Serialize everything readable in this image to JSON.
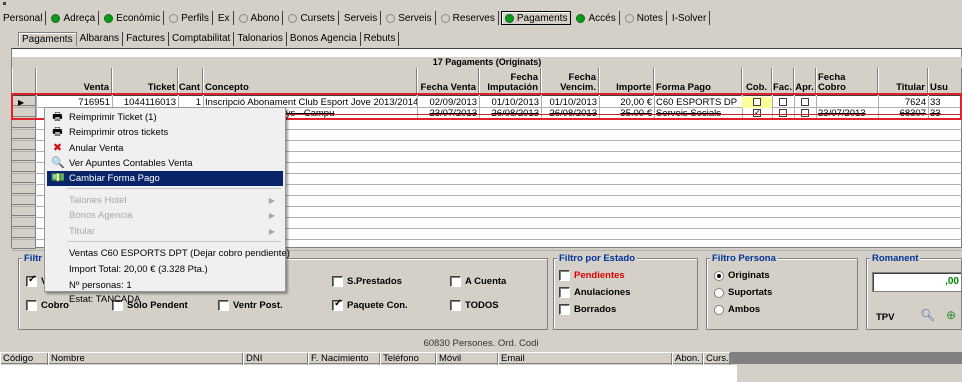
{
  "top_tabs": [
    {
      "label": "Personal",
      "dot": "none"
    },
    {
      "label": "Adreça",
      "dot": "green"
    },
    {
      "label": "Econòmic",
      "dot": "green"
    },
    {
      "label": "Perfils",
      "dot": "grey"
    },
    {
      "label": "Ex",
      "dot": "none"
    },
    {
      "label": "Abono",
      "dot": "grey"
    },
    {
      "label": "Cursets",
      "dot": "grey"
    },
    {
      "label": "Serveis",
      "dot": "none"
    },
    {
      "label": "Serveis",
      "dot": "grey"
    },
    {
      "label": "Reserves",
      "dot": "grey"
    },
    {
      "label": "Pagaments",
      "dot": "green",
      "active": true
    },
    {
      "label": "Accés",
      "dot": "green"
    },
    {
      "label": "Notes",
      "dot": "grey"
    },
    {
      "label": "I-Solver",
      "dot": "none"
    }
  ],
  "sub_tabs": [
    "Pagaments",
    "Albarans",
    "Factures",
    "Comptabilitat",
    "Talonarios",
    "Bonos Agencia",
    "Rebuts"
  ],
  "grid": {
    "caption": "17 Pagaments (Originats)",
    "columns": {
      "venta": "Venta",
      "ticket": "Ticket",
      "cant": "Cant",
      "concepto": "Concepto",
      "fecha_venta": "Fecha Venta",
      "fecha_imputacion": "Fecha Imputación",
      "fecha_vencim": "Fecha Vencim.",
      "importe": "Importe",
      "forma_pago": "Forma Pago",
      "cob": "Cob.",
      "fac": "Fac.",
      "apr": "Apr.",
      "fecha_cobro": "Fecha Cobro",
      "titular": "Titular",
      "usu": "Usu"
    },
    "rows": [
      {
        "venta": "716951",
        "ticket": "1044116013",
        "cant": "1",
        "concepto": "Inscripció Abonament Club Esport Jove 2013/2014",
        "fecha_venta": "02/09/2013",
        "fecha_imputacion": "01/10/2013",
        "fecha_vencim": "01/10/2013",
        "importe": "20,00 €",
        "forma_pago": "C60 ESPORTS DP",
        "cob": false,
        "fac": false,
        "apr": false,
        "fecha_cobro": "",
        "titular": "7624",
        "usu": "33"
      },
      {
        "venta": "",
        "ticket": "",
        "cant": "",
        "concepto": "3 Prat de 7 a 16 anys - Campu",
        "fecha_venta": "23/07/2013",
        "fecha_imputacion": "26/08/2013",
        "fecha_vencim": "26/08/2013",
        "importe": "35.00 €",
        "forma_pago": "Serveis Socials",
        "cob": true,
        "fac": false,
        "apr": false,
        "fecha_cobro": "23/07/2013",
        "titular": "68307",
        "usu": "33"
      }
    ]
  },
  "context_menu": {
    "items": [
      {
        "label": "Reimprimir Ticket (1)",
        "icon": "printer-icon",
        "glyph": "🖶",
        "disabled": false,
        "highlighted": false,
        "submenu": false
      },
      {
        "label": "Reimprimir otros tickets",
        "icon": "printer-icon",
        "glyph": "🖶",
        "disabled": false,
        "highlighted": false,
        "submenu": false
      },
      {
        "label": "Anular Venta",
        "icon": "red-x-icon",
        "glyph": "✖",
        "disabled": false,
        "highlighted": false,
        "submenu": false
      },
      {
        "label": "Ver Apuntes Contables Venta",
        "icon": "magnifier-icon",
        "glyph": "🔍",
        "disabled": false,
        "highlighted": false,
        "submenu": false
      },
      {
        "label": "Cambiar Forma Pago",
        "icon": "money-icon",
        "glyph": "💵",
        "disabled": false,
        "highlighted": true,
        "submenu": false
      },
      {
        "label": "Talones Hotel",
        "disabled": true,
        "submenu": true
      },
      {
        "label": "Bonos Agencia",
        "disabled": true,
        "submenu": true
      },
      {
        "label": "Titular",
        "disabled": true,
        "submenu": true
      },
      {
        "label": "Ventas C60 ESPORTS DPT (Dejar cobro pendiente)",
        "disabled": false,
        "submenu": false
      },
      {
        "label": "Import Total: 20,00 € (3.328 Pta.)",
        "disabled": false,
        "submenu": false
      },
      {
        "label": "Nº personas: 1",
        "disabled": false,
        "submenu": false
      },
      {
        "label": "Estat: TANCADA",
        "disabled": false,
        "submenu": false
      }
    ]
  },
  "filters": {
    "left_label": "Filtr",
    "left_check_v": "V",
    "left_cobro": "Cobro",
    "left_hidden_1": "Sólo Pendent",
    "left_hidden_2": "Ventr Post.",
    "s_prestados": "S.Prestados",
    "a_cuenta": "A Cuenta",
    "paquete_con": "Paquete Con.",
    "todos": "TODOS",
    "estado": {
      "title": "Filtro por Estado",
      "pendientes": "Pendientes",
      "anulaciones": "Anulaciones",
      "borrados": "Borrados"
    },
    "persona": {
      "title": "Filtro Persona",
      "originats": "Originats",
      "suportats": "Suportats",
      "ambos": "Ambos"
    },
    "romanent": {
      "title": "Romanent",
      "value": ",00",
      "tpv": "TPV"
    }
  },
  "status_line": "60830 Persones. Ord. Codi",
  "bottom_columns": [
    "Código",
    "Nombre",
    "DNI",
    "F. Nacimiento",
    "Teléfono",
    "Móvil",
    "Email",
    "Abon.",
    "Curs."
  ],
  "colors": {
    "accent_green": "#0c9a1c",
    "highlight": "#0a246a",
    "selection_red": "#e0202a",
    "group_label": "#003399",
    "pendientes_red": "#e00000"
  }
}
